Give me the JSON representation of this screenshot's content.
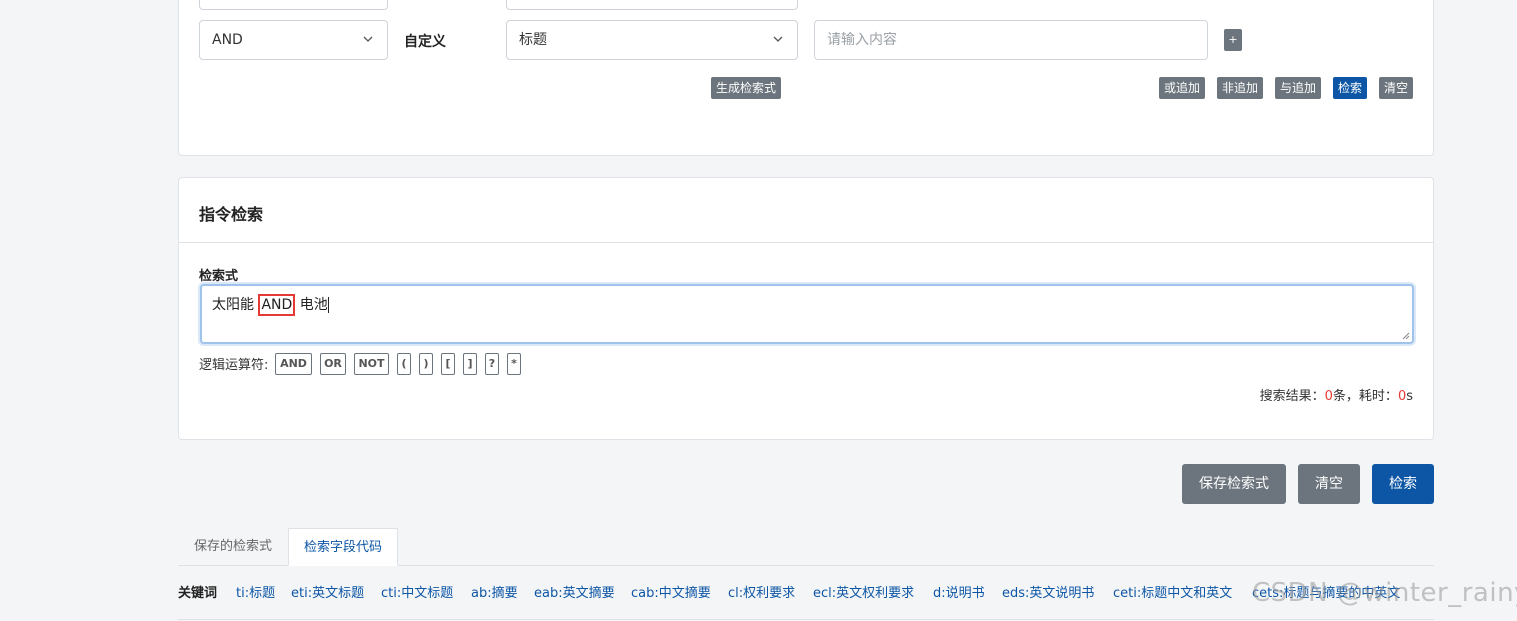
{
  "advanced": {
    "logic_select": "AND",
    "field_label": "自定义",
    "field_select": "标题",
    "input_placeholder": "请输入内容",
    "add_label": "+",
    "generate_label": "生成检索式",
    "or_add_label": "或追加",
    "not_add_label": "非追加",
    "and_add_label": "与追加",
    "search_label": "检索",
    "clear_label": "清空"
  },
  "command": {
    "title": "指令检索",
    "expr_label": "检索式",
    "expr_before": "太阳能 ",
    "expr_highlight": "AND",
    "expr_after": " 电池",
    "operators_label": "逻辑运算符:",
    "operators": [
      "AND",
      "OR",
      "NOT",
      "(",
      ")",
      "[",
      "]",
      "?",
      "*"
    ],
    "result_prefix": "搜索结果：",
    "result_count": "0",
    "result_mid": "条，耗时：",
    "result_time": "0",
    "result_unit": "s"
  },
  "actions": {
    "save_label": "保存检索式",
    "clear_label": "清空",
    "search_label": "检索"
  },
  "tabs": [
    "保存的检索式",
    "检索字段代码"
  ],
  "keywords": {
    "title": "关键词",
    "items": [
      "ti:标题",
      "eti:英文标题",
      "cti:中文标题",
      "ab:摘要",
      "eab:英文摘要",
      "cab:中文摘要",
      "cl:权利要求",
      "ecl:英文权利要求",
      "d:说明书",
      "eds:英文说明书",
      "ceti:标题中文和英文",
      "cets:标题与摘要的中英文"
    ]
  },
  "watermark": "CSDN @winter_rainy",
  "colors": {
    "primary": "#0d56a6",
    "secondary": "#6c757d",
    "highlight": "#e53935"
  }
}
